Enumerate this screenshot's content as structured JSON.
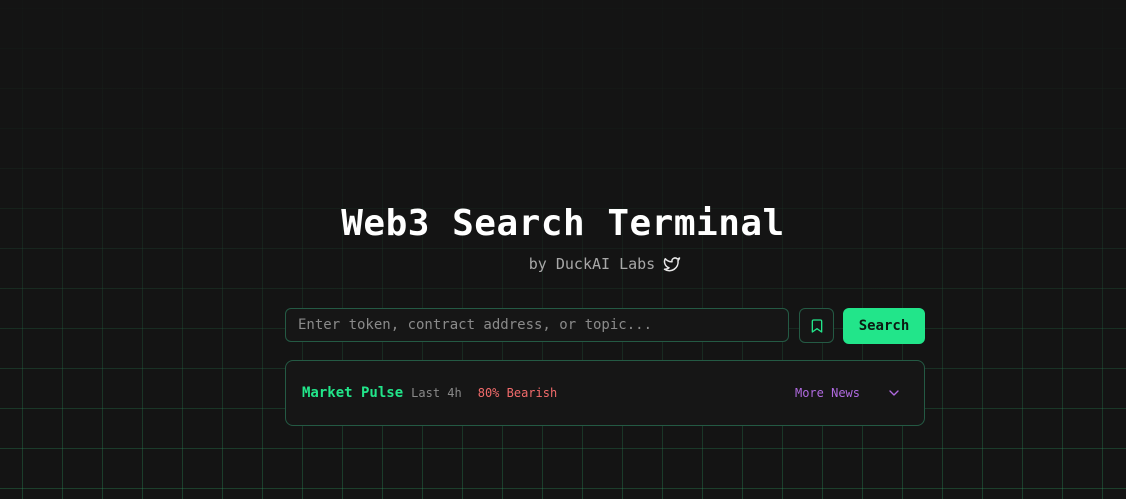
{
  "header": {
    "title": "Web3 Search Terminal",
    "byline": "by DuckAI Labs",
    "byline_icon": "twitter-bird-icon"
  },
  "search": {
    "placeholder": "Enter token, contract address, or topic...",
    "value": "",
    "bookmark_icon": "bookmark-icon",
    "button_label": "Search"
  },
  "pulse": {
    "title": "Market Pulse",
    "time_range": "Last 4h",
    "sentiment": "80% Bearish",
    "more_label": "More News",
    "expand_icon": "chevron-down-icon"
  },
  "colors": {
    "background": "#141414",
    "accent": "#22e58a",
    "border": "#245a44",
    "bearish": "#f26b6b",
    "link": "#b06ae0"
  }
}
